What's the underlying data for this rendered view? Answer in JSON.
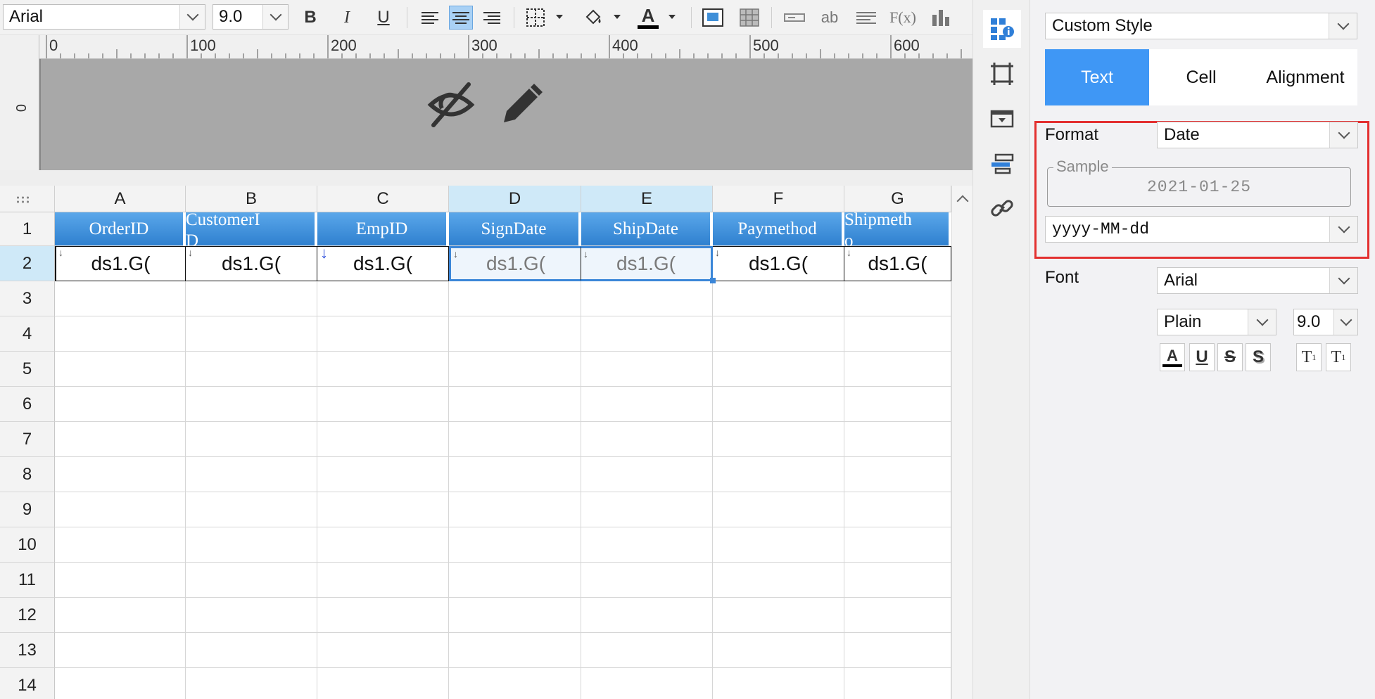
{
  "toolbar": {
    "font_family": "Arial",
    "font_size": "9.0",
    "bold": "B",
    "italic": "I",
    "underline": "U",
    "text_abbrev": "ab",
    "formula": "F(x)",
    "font_color_letter": "A",
    "font_color": "#000000",
    "icons": [
      "bold-icon",
      "italic-icon",
      "underline-icon",
      "align-left-icon",
      "align-center-icon",
      "align-right-icon",
      "border-icon",
      "fill-color-icon",
      "font-color-icon",
      "insert-image-icon",
      "insert-grid-icon",
      "insert-text-field-icon",
      "text-icon",
      "align-justify-icon",
      "formula-icon",
      "chart-icon"
    ]
  },
  "ruler": {
    "vertical_zero": "0",
    "labels": [
      "0",
      "100",
      "200",
      "300",
      "400",
      "500",
      "600"
    ]
  },
  "band": {
    "icons": [
      "hide-eye-icon",
      "pencil-edit-icon"
    ]
  },
  "sheet": {
    "columns": [
      "A",
      "B",
      "C",
      "D",
      "E",
      "F",
      "G"
    ],
    "selected_columns": [
      "D",
      "E"
    ],
    "rows": [
      "1",
      "2",
      "3",
      "4",
      "5",
      "6",
      "7",
      "8",
      "9",
      "10",
      "11",
      "12",
      "13",
      "14"
    ],
    "selected_row": "2",
    "header_row": [
      "OrderID",
      "CustomerI",
      "EmpID",
      "SignDate",
      "ShipDate",
      "Paymethod",
      "Shipmeth"
    ],
    "header_row_second_line": [
      "",
      "D",
      "",
      "",
      "",
      "",
      "o"
    ],
    "data_row": [
      "ds1.G(",
      "ds1.G(",
      "ds1.G(",
      "ds1.G(",
      "ds1.G(",
      "ds1.G(",
      "ds1.G("
    ],
    "header_fill": "#3f8fd8",
    "selection_color": "#3b86d8"
  },
  "strip": {
    "icons": [
      "cell-properties-icon",
      "cell-border-icon",
      "widget-icon",
      "condition-icon",
      "hyperlink-icon"
    ]
  },
  "panel": {
    "style_select": "Custom Style",
    "tabs": [
      "Text",
      "Cell",
      "Alignment"
    ],
    "active_tab": "Text",
    "format_label": "Format",
    "format_value": "Date",
    "sample_legend": "Sample",
    "sample_value": "2021-01-25",
    "pattern_value": "yyyy-MM-dd",
    "font_label": "Font",
    "font_family": "Arial",
    "font_style": "Plain",
    "font_size": "9.0",
    "accent_color": "#3f97f5",
    "highlight_color": "#e33030"
  }
}
